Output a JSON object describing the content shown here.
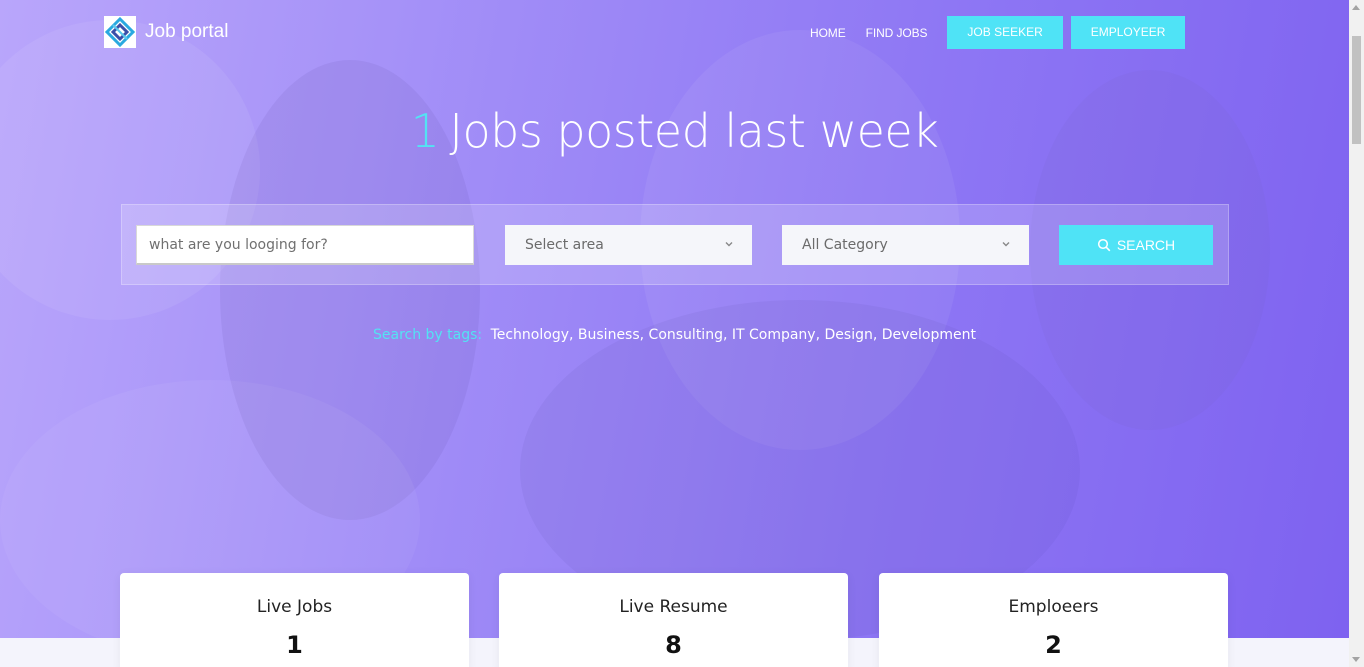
{
  "brand": {
    "name": "Job portal",
    "icon": "logo-icon"
  },
  "nav": {
    "home": "HOME",
    "find_jobs": "FIND JOBS",
    "job_seeker": "JOB SEEKER",
    "employer": "EMPLOYEER"
  },
  "headline": {
    "count": "1",
    "text": "Jobs posted last week"
  },
  "search": {
    "placeholder": "what are you looging for?",
    "area": "Select area",
    "category": "All Category",
    "button": "SEARCH",
    "button_icon": "search-icon"
  },
  "tags": {
    "label": "Search by tags:",
    "items": [
      "Technology,",
      "Business,",
      "Consulting,",
      "IT Company,",
      "Design,",
      "Development"
    ]
  },
  "stats": [
    {
      "label": "Live Jobs",
      "value": "1"
    },
    {
      "label": "Live Resume",
      "value": "8"
    },
    {
      "label": "Emploeers",
      "value": "2"
    }
  ],
  "colors": {
    "accent": "#4fe3f6",
    "hero_start": "#b9a6fb",
    "hero_end": "#7e62f0"
  }
}
